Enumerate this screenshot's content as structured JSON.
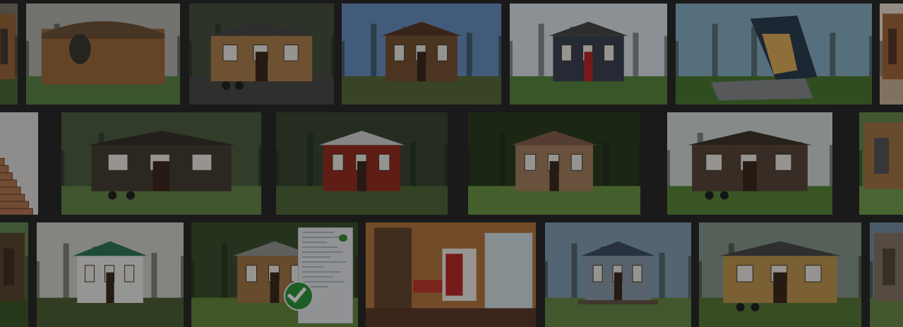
{
  "grid": {
    "rows": [
      {
        "tiles": [
          {
            "name": "thumbnail-0",
            "sky": "#7e7a70",
            "ground": "#4f6d34",
            "wall": "#9b6a3a",
            "roof": "#4c3d34",
            "type": "edge"
          },
          {
            "name": "thumbnail-1",
            "sky": "#b8b8b2",
            "ground": "#5e8a4b",
            "wall": "#a46d3d",
            "roof": "#73563a",
            "type": "curved"
          },
          {
            "name": "thumbnail-2",
            "sky": "#495342",
            "ground": "#4d4d4a",
            "wall": "#b0844f",
            "roof": "#4b4b4b",
            "type": "trailer"
          },
          {
            "name": "thumbnail-3",
            "sky": "#6b94c6",
            "ground": "#5c6d3d",
            "wall": "#7b5634",
            "roof": "#5d3c28",
            "type": "gable"
          },
          {
            "name": "thumbnail-4",
            "sky": "#dfe8ef",
            "ground": "#5b8b3f",
            "wall": "#3c4554",
            "roof": "#4a4a4a",
            "type": "modern"
          },
          {
            "name": "thumbnail-5",
            "sky": "#8cb4c8",
            "ground": "#4e7d35",
            "wall": "#2e3f55",
            "roof": "#2a3244",
            "type": "a-frame"
          },
          {
            "name": "thumbnail-6",
            "sky": "#f0e4d6",
            "ground": "#cdb99a",
            "wall": "#a56a3e",
            "roof": "#573b27",
            "type": "edge"
          }
        ]
      },
      {
        "tiles": [
          {
            "name": "thumbnail-7",
            "sky": "#e6e4e0",
            "ground": "#a86a44",
            "wall": "#b77953",
            "roof": "#8a5a3a",
            "type": "stairs"
          },
          {
            "name": "thumbnail-8",
            "sky": "#4f6245",
            "ground": "#6a8a4c",
            "wall": "#4a4038",
            "roof": "#3b322b",
            "type": "trailer"
          },
          {
            "name": "thumbnail-9",
            "sky": "#3a4a33",
            "ground": "#536b3b",
            "wall": "#9c2f22",
            "roof": "#d8d8d8",
            "type": "cottage"
          },
          {
            "name": "thumbnail-10",
            "sky": "#2c4021",
            "ground": "#6f9a47",
            "wall": "#a88463",
            "roof": "#8a6550",
            "type": "gable"
          },
          {
            "name": "thumbnail-11",
            "sky": "#d7e1dc",
            "ground": "#5c8a3b",
            "wall": "#5b4a3a",
            "roof": "#3f352c",
            "type": "trailer"
          },
          {
            "name": "thumbnail-12",
            "sky": "#6c8c4f",
            "ground": "#76a352",
            "wall": "#a87a48",
            "roof": "#5a5a5a",
            "type": "edge"
          }
        ]
      },
      {
        "tiles": [
          {
            "name": "thumbnail-13",
            "sky": "#6a8c55",
            "ground": "#415c2c",
            "wall": "#5b4a33",
            "roof": "#3f3327",
            "type": "edge"
          },
          {
            "name": "thumbnail-14",
            "sky": "#d6d7cf",
            "ground": "#506339",
            "wall": "#f1f1ee",
            "roof": "#2f7a59",
            "type": "white"
          },
          {
            "name": "thumbnail-15",
            "sky": "#3d5130",
            "ground": "#6a8b3e",
            "wall": "#a77a4a",
            "roof": "#9a9a96",
            "type": "gable"
          },
          {
            "name": "thumbnail-16",
            "sky": "#d9d0c3",
            "ground": "#5f3b2a",
            "wall": "#b87a42",
            "roof": "#6a4a33",
            "type": "interior"
          },
          {
            "name": "thumbnail-17",
            "sky": "#86a2b8",
            "ground": "#6b8d4b",
            "wall": "#8fa0b0",
            "roof": "#3f4f6a",
            "type": "porch"
          },
          {
            "name": "thumbnail-18",
            "sky": "#8a9b8f",
            "ground": "#5c7d3b",
            "wall": "#c69b52",
            "roof": "#4c4c4c",
            "type": "trailer"
          },
          {
            "name": "thumbnail-19",
            "sky": "#7994a9",
            "ground": "#6c8b49",
            "wall": "#8b7a68",
            "roof": "#594b3e",
            "type": "edge"
          }
        ]
      }
    ]
  },
  "colors": {
    "overlay": "#000000",
    "background": "#2b2b2b",
    "check": "#2e9a3c"
  },
  "icons": {
    "checkmark": "check-circle-icon"
  }
}
